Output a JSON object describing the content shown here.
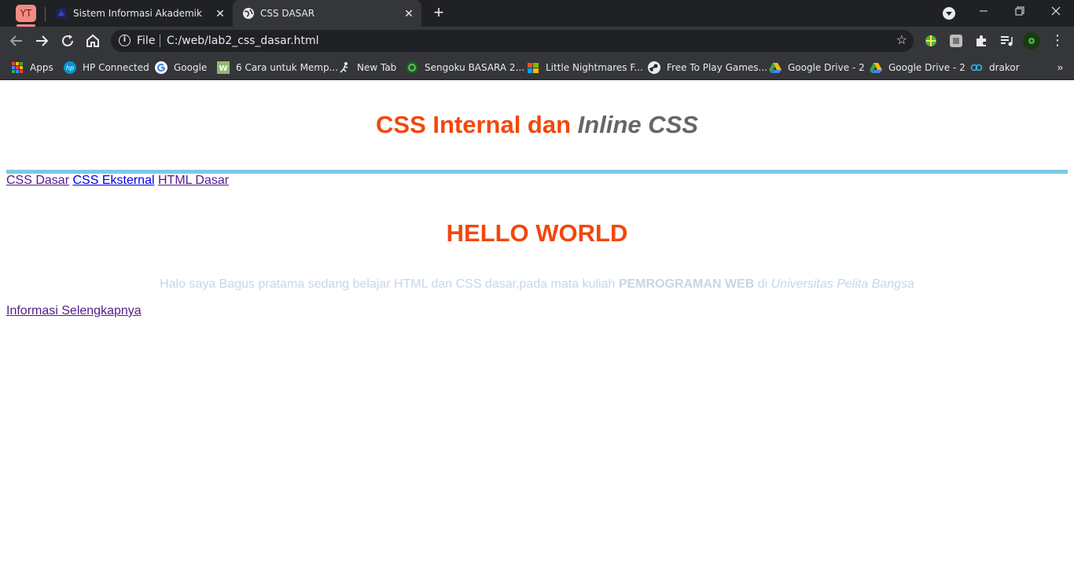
{
  "browser": {
    "tab_group_label": "YT",
    "tabs": [
      {
        "title": "Sistem Informasi Akademik"
      },
      {
        "title": "CSS DASAR"
      }
    ],
    "address": {
      "scheme_label": "File",
      "url": "C:/web/lab2_css_dasar.html"
    },
    "bookmarks": [
      {
        "label": "Apps"
      },
      {
        "label": "HP Connected"
      },
      {
        "label": "Google"
      },
      {
        "label": "6 Cara untuk Memp..."
      },
      {
        "label": "New Tab"
      },
      {
        "label": "Sengoku BASARA 2..."
      },
      {
        "label": "Little Nightmares F..."
      },
      {
        "label": "Free To Play Games..."
      },
      {
        "label": "Google Drive - 2"
      },
      {
        "label": "Google Drive - 2"
      },
      {
        "label": "drakor"
      }
    ]
  },
  "page": {
    "heading": {
      "part1": "CSS Internal dan ",
      "part2": "Inline",
      "part3": " CSS"
    },
    "nav": [
      {
        "label": "CSS Dasar"
      },
      {
        "label": "CSS Eksternal"
      },
      {
        "label": "HTML Dasar"
      }
    ],
    "hello": "HELLO WORLD",
    "paragraph": {
      "text": "Halo saya Bagus pratama sedang belajar HTML dan CSS dasar,pada mata kuliah ",
      "bold": "PEMROGRAMAN WEB",
      "mid": " di ",
      "italic": "Universitas Pelita Bangsa"
    },
    "more_link": "Informasi Selengkapnya"
  },
  "colors": {
    "heading_accent": "#f4470b",
    "heading_italic": "#666666",
    "rule": "#7ec8e3",
    "paragraph": "#c8d6e5",
    "visited_link": "#551a8b",
    "link": "#0000ee"
  }
}
